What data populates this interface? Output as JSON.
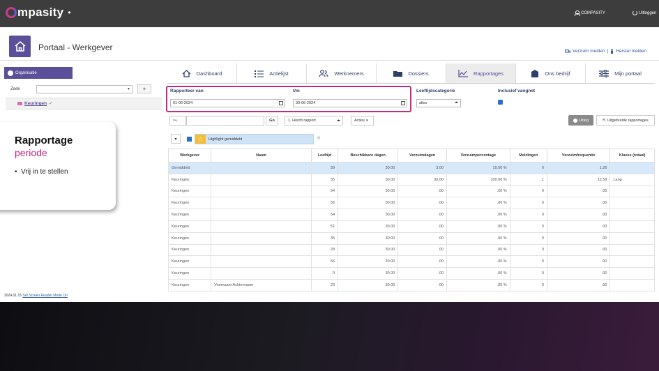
{
  "app": {
    "logo": "mpasity",
    "logo_sub": "",
    "user": "COMPASITY",
    "logout": "Uitloggen"
  },
  "header": {
    "title": "Portaal - Werkgever",
    "link_verzuim": "Verzuim melden",
    "separator": "|",
    "link_herstel": "Herstel melden"
  },
  "sidebar": {
    "org_label": "Organisatie",
    "zoek_label": "Zoek",
    "zoek_value": "",
    "add_label": "+",
    "tree_item": "Keuringen"
  },
  "callout": {
    "title": "Rapportage",
    "subtitle": "periode",
    "bullet": "Vrij in te stellen"
  },
  "version": {
    "text": "2024.01.15",
    "link": "Set Screen Reader Mode On"
  },
  "tabs": [
    {
      "label": "Dashboard",
      "icon": "home-icon"
    },
    {
      "label": "Actielijst",
      "icon": "list-icon"
    },
    {
      "label": "Werknemers",
      "icon": "users-icon"
    },
    {
      "label": "Dossiers",
      "icon": "folder-icon"
    },
    {
      "label": "Rapportages",
      "icon": "chart-icon",
      "active": true
    },
    {
      "label": "Ons bedrijf",
      "icon": "building-icon"
    },
    {
      "label": "Mijn portaal",
      "icon": "sliders-icon"
    }
  ],
  "filters": {
    "van_label": "Rapporteer van",
    "van_value": "01-06-2024",
    "tm_label": "t/m",
    "tm_value": "30-06-2024",
    "leeftijd_label": "Leeftijdscategorie",
    "leeftijd_value": "alles",
    "vangnet_label": "Inclusief vangnet",
    "vangnet_checked": true,
    "highlight_color": "#c8287e"
  },
  "toolbar": {
    "search_value": "",
    "go": "Go",
    "rapport": "1. Hoofd rapport",
    "acties": "Acties",
    "uitleg": "Uitleg",
    "uitgebreid": "Uitgebreide rapportages"
  },
  "highlight": {
    "label": "Highlight gemiddeld",
    "checked": true
  },
  "table": {
    "headers": [
      "Werkgever",
      "Naam",
      "Leeftijd",
      "Beschikbare dagen",
      "Verzuimdagen",
      "Verzuimpercentage",
      "Meldingen",
      "Verzuimfrequentie",
      "Klasse (totaal)"
    ],
    "rows": [
      [
        "Gemiddeld",
        "",
        "39",
        "30.00",
        "3.00",
        "10.00 %",
        "0",
        "1.26",
        ""
      ],
      [
        "Keuringen",
        "",
        "35",
        "30.00",
        "30.00",
        "100.00 %",
        "1",
        "12.59",
        "Lang"
      ],
      [
        "Keuringen",
        "",
        "54",
        "30.00",
        ".00",
        ".00 %",
        "0",
        ".00",
        ""
      ],
      [
        "Keuringen",
        "",
        "56",
        "30.00",
        ".00",
        ".00 %",
        "0",
        ".00",
        ""
      ],
      [
        "Keuringen",
        "",
        "54",
        "30.00",
        ".00",
        ".00 %",
        "0",
        ".00",
        ""
      ],
      [
        "Keuringen",
        "",
        "51",
        "30.00",
        ".00",
        ".00 %",
        "0",
        ".00",
        ""
      ],
      [
        "Keuringen",
        "",
        "35",
        "30.00",
        ".00",
        ".00 %",
        "0",
        ".00",
        ""
      ],
      [
        "Keuringen",
        "",
        "28",
        "30.00",
        ".00",
        ".00 %",
        "0",
        ".00",
        ""
      ],
      [
        "Keuringen",
        "",
        "56",
        "30.00",
        ".00",
        ".00 %",
        "0",
        ".00",
        ""
      ],
      [
        "Keuringen",
        "",
        "0",
        "30.00",
        ".00",
        ".00 %",
        "0",
        ".00",
        ""
      ],
      [
        "Keuringen",
        "Voornaam Achternaam",
        "23",
        "30.00",
        ".00",
        ".00 %",
        "0",
        ".00",
        ""
      ]
    ]
  }
}
